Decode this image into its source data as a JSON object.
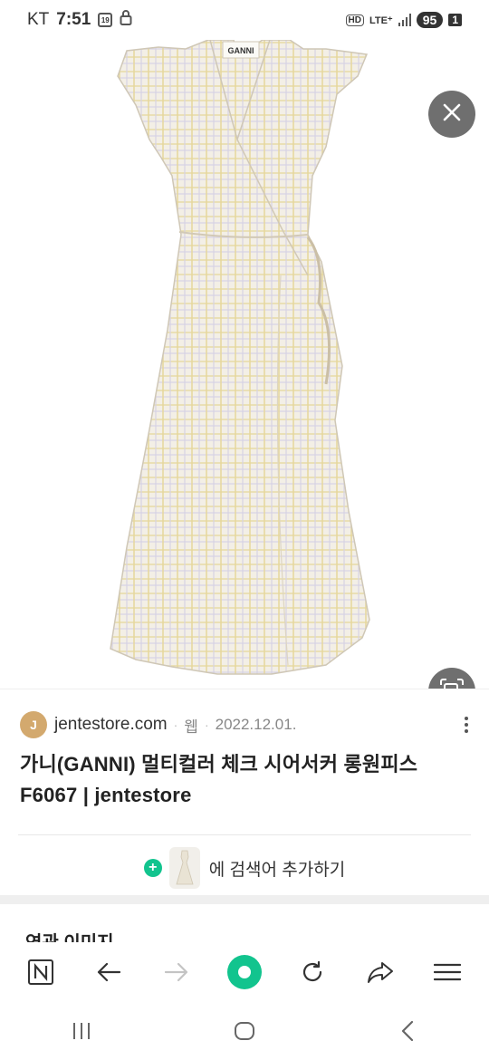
{
  "status_bar": {
    "carrier": "KT",
    "time": "7:51",
    "calendar_badge": "19",
    "network_hd": "HD",
    "network_type": "LTE⁺",
    "battery": "95",
    "sim": "1"
  },
  "image_viewer": {
    "close_icon": "close-icon",
    "lens_icon": "image-search-icon",
    "garment_label": "GANNI"
  },
  "result": {
    "source_initial": "J",
    "source_domain": "jentestore.com",
    "source_type": "웹",
    "source_date": "2022.12.01.",
    "title": "가니(GANNI) 멀티컬러 체크 시어서커 롱원피스 F6067 | jentestore",
    "add_to_search_label": "에 검색어 추가하기"
  },
  "related": {
    "heading": "연관 이미지"
  },
  "browser_nav": {
    "items": [
      "naver-home-icon",
      "back-arrow-icon",
      "forward-arrow-icon",
      "green-dot-icon",
      "reload-icon",
      "share-icon",
      "menu-icon"
    ]
  },
  "system_nav": {
    "items": [
      "recent-apps-icon",
      "home-icon",
      "back-icon"
    ]
  },
  "colors": {
    "accent_green": "#12c48e",
    "overlay_button": "#6f6f6f",
    "source_avatar": "#d3a96e"
  }
}
